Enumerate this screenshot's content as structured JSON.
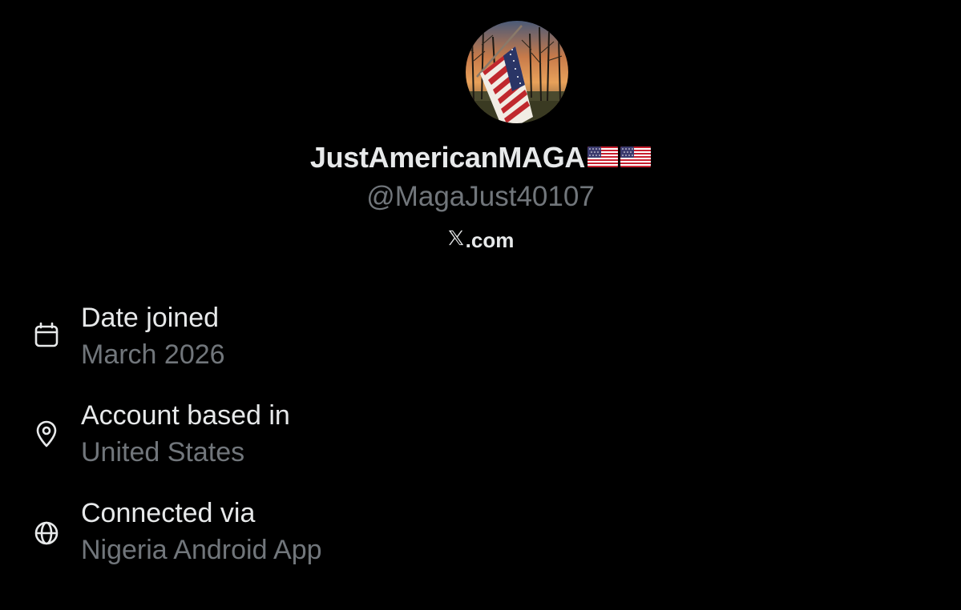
{
  "profile": {
    "display_name": "JustAmericanMAGA",
    "name_emojis": [
      "us-flag-emoji",
      "us-flag-emoji"
    ],
    "handle": "@MagaJust40107",
    "site_suffix": ".com",
    "site_icon": "x-logo-icon",
    "avatar_description_icon": "american-flag-avatar"
  },
  "about": {
    "items": [
      {
        "icon": "calendar-icon",
        "label": "Date joined",
        "value": "March 2026"
      },
      {
        "icon": "location-pin-icon",
        "label": "Account based in",
        "value": "United States"
      },
      {
        "icon": "globe-icon",
        "label": "Connected via",
        "value": "Nigeria Android App"
      }
    ]
  },
  "colors": {
    "background": "#000000",
    "primary_text": "#e7e9ea",
    "secondary_text": "#71767b"
  }
}
